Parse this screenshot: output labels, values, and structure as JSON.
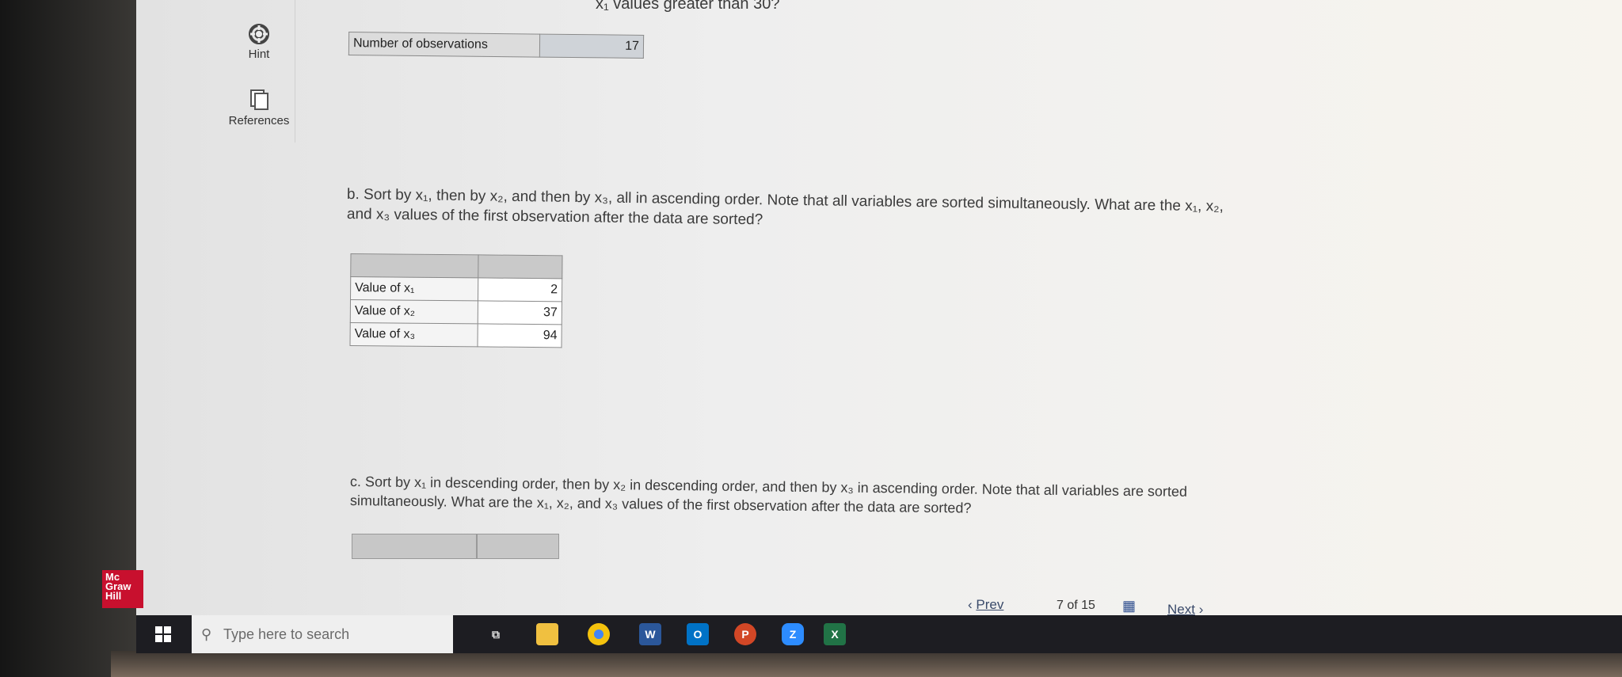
{
  "question_a_tail": "x₁ values greater than 30?",
  "hint_label": "Hint",
  "references_label": "References",
  "part_a_table": {
    "label": "Number of observations",
    "value": "17"
  },
  "part_b": {
    "line1_a": "b. Sort by x₁, then by x₂, and then by x₃, all in ascending order. Note that all variables are sorted simultaneously. What are the x₁, x₂,",
    "line2": "and x₃ values of the first observation after the data are sorted?",
    "rows": [
      {
        "label": "Value of x₁",
        "value": "2"
      },
      {
        "label": "Value of x₂",
        "value": "37"
      },
      {
        "label": "Value of x₃",
        "value": "94"
      }
    ]
  },
  "part_c": {
    "line1": "c. Sort by x₁ in descending order, then by x₂ in descending order, and then by x₃ in ascending order. Note that all variables are sorted",
    "line2": "simultaneously. What are the x₁, x₂, and x₃ values of the first observation after the data are sorted?"
  },
  "nav": {
    "prev": "Prev",
    "page_current": "7",
    "page_of": "of",
    "page_total": "15",
    "next": "Next"
  },
  "logo": {
    "line1": "Mc",
    "line2": "Graw",
    "line3": "Hill"
  },
  "taskbar": {
    "search_placeholder": "Type here to search",
    "apps": [
      "task-view",
      "file-explorer",
      "chrome",
      "word",
      "outlook",
      "powerpoint",
      "zoom",
      "excel"
    ]
  }
}
